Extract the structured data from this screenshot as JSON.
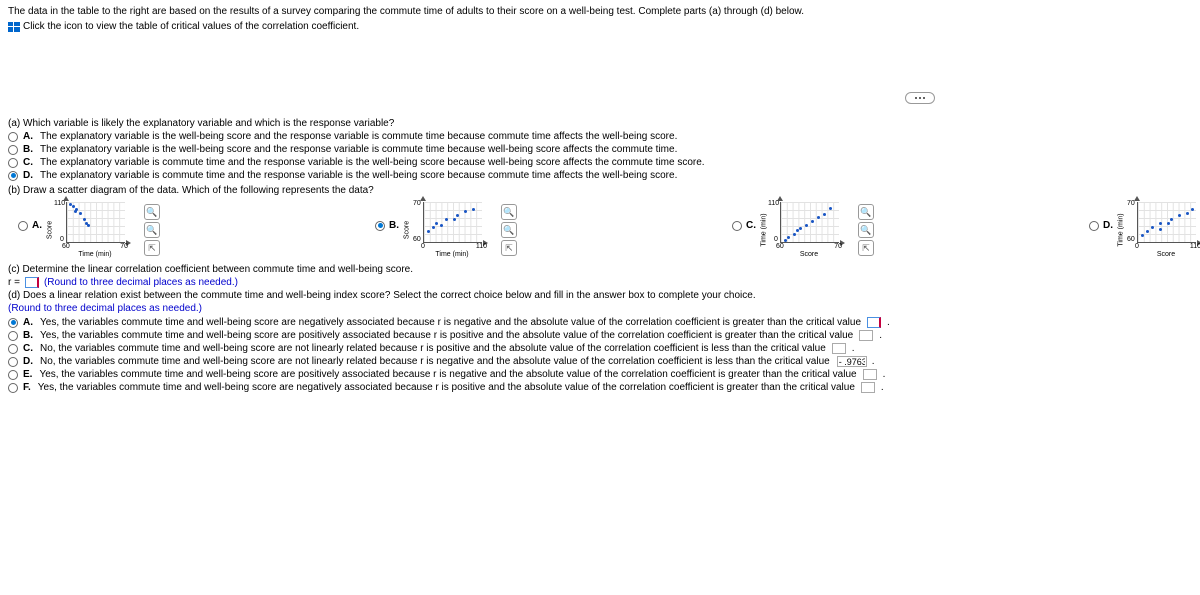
{
  "intro": "The data in the table to the right are based on the results of a survey comparing the commute time of adults to their score on a well-being test. Complete parts (a) through (d) below.",
  "link": "Click the icon to view the table of critical values of the correlation coefficient.",
  "partA": {
    "q": "(a) Which variable is likely the explanatory variable and which is the response variable?",
    "opts": {
      "A": "The explanatory variable is the well-being score and the response variable is commute time because commute time affects the well-being score.",
      "B": "The explanatory variable is the well-being score and the response variable is commute time because well-being score affects the commute time.",
      "C": "The explanatory variable is commute time and the response variable is the well-being score because well-being score affects the commute time score.",
      "D": "The explanatory variable is commute time and the response variable is the well-being score because commute time affects the well-being score."
    }
  },
  "partB": {
    "q": "(b) Draw a scatter diagram of the data. Which of the following represents the data?",
    "labels": {
      "A": "A.",
      "B": "B.",
      "C": "C.",
      "D": "D."
    }
  },
  "plots": {
    "A": {
      "ylabel": "Score",
      "xlabel": "Time (min)",
      "ymin": "0",
      "ymax": "110",
      "xmin": "60",
      "xmax": "70"
    },
    "B": {
      "ylabel": "Score",
      "xlabel": "Time (min)",
      "ymin": "60",
      "ymax": "70",
      "xmin": "0",
      "xmax": "110"
    },
    "C": {
      "ylabel": "Time (min)",
      "xlabel": "Score",
      "ymin": "0",
      "ymax": "110",
      "xmin": "60",
      "xmax": "70"
    },
    "D": {
      "ylabel": "Time (min)",
      "xlabel": "Score",
      "ymin": "60",
      "ymax": "70",
      "xmin": "0",
      "xmax": "110"
    }
  },
  "partC": {
    "q": "(c) Determine the linear correlation coefficient between commute time and well-being score.",
    "eq": "r =",
    "hint": "(Round to three decimal places as needed.)"
  },
  "partD": {
    "q": "(d) Does a linear relation exist between the commute time and well-being index score? Select the correct choice below and fill in the answer box to complete your choice.",
    "hint": "(Round to three decimal places as needed.)",
    "opts": {
      "A": "Yes, the variables commute time and well-being score are negatively associated because r is negative and the absolute value of the correlation coefficient is greater than the critical value",
      "B": "Yes, the variables commute time and well-being score are positively associated because r is positive and the absolute value of the correlation coefficient is greater than the critical value",
      "C": "No, the variables commute time and well-being score are not linearly related because r is positive and the absolute value of the correlation coefficient is less than the critical value",
      "D": "No, the variables commute time and well-being score are not linearly related because r is negative and the absolute value of the correlation coefficient is less than the critical value",
      "E": "Yes, the variables commute time and well-being score are positively associated because r is negative and the absolute value of the correlation coefficient is greater than the critical value",
      "F": "Yes, the variables commute time and well-being score are negatively associated because r is positive and the absolute value of the correlation coefficient is greater than the critical value"
    },
    "valD": "- .9763"
  },
  "period": ".",
  "chart_data": [
    {
      "type": "scatter",
      "label": "A",
      "xlabel": "Time (min)",
      "ylabel": "Score",
      "xlim": [
        60,
        70
      ],
      "ylim": [
        0,
        110
      ],
      "comment": "points cluster top-left, downward trend toward lower-right",
      "points": [
        [
          60.5,
          108
        ],
        [
          61,
          100
        ],
        [
          62,
          92
        ],
        [
          61.5,
          90
        ],
        [
          62.5,
          85
        ],
        [
          63,
          70
        ],
        [
          64,
          50
        ],
        [
          63.5,
          55
        ]
      ]
    },
    {
      "type": "scatter",
      "label": "B",
      "xlabel": "Time (min)",
      "ylabel": "Score",
      "xlim": [
        0,
        110
      ],
      "ylim": [
        60,
        70
      ],
      "comment": "points rise left to right",
      "points": [
        [
          5,
          63
        ],
        [
          15,
          64
        ],
        [
          20,
          65
        ],
        [
          30,
          64.5
        ],
        [
          40,
          66
        ],
        [
          55,
          66
        ],
        [
          60,
          67
        ],
        [
          75,
          68
        ],
        [
          90,
          68.5
        ]
      ]
    },
    {
      "type": "scatter",
      "label": "C",
      "xlabel": "Score",
      "ylabel": "Time (min)",
      "xlim": [
        60,
        70
      ],
      "ylim": [
        0,
        110
      ],
      "comment": "points rise left to right",
      "points": [
        [
          60.5,
          8
        ],
        [
          61,
          15
        ],
        [
          62,
          25
        ],
        [
          62.5,
          35
        ],
        [
          63,
          40
        ],
        [
          64,
          50
        ],
        [
          65,
          60
        ],
        [
          66,
          70
        ],
        [
          67,
          80
        ],
        [
          68,
          95
        ]
      ]
    },
    {
      "type": "scatter",
      "label": "D",
      "xlabel": "Score",
      "ylabel": "Time (min)",
      "xlim": [
        0,
        110
      ],
      "ylim": [
        60,
        70
      ],
      "comment": "points rise left to right",
      "points": [
        [
          5,
          62
        ],
        [
          15,
          63
        ],
        [
          25,
          64
        ],
        [
          40,
          63.5
        ],
        [
          40,
          65
        ],
        [
          55,
          65
        ],
        [
          60,
          66
        ],
        [
          75,
          67
        ],
        [
          90,
          67.5
        ],
        [
          100,
          68.5
        ]
      ]
    }
  ]
}
